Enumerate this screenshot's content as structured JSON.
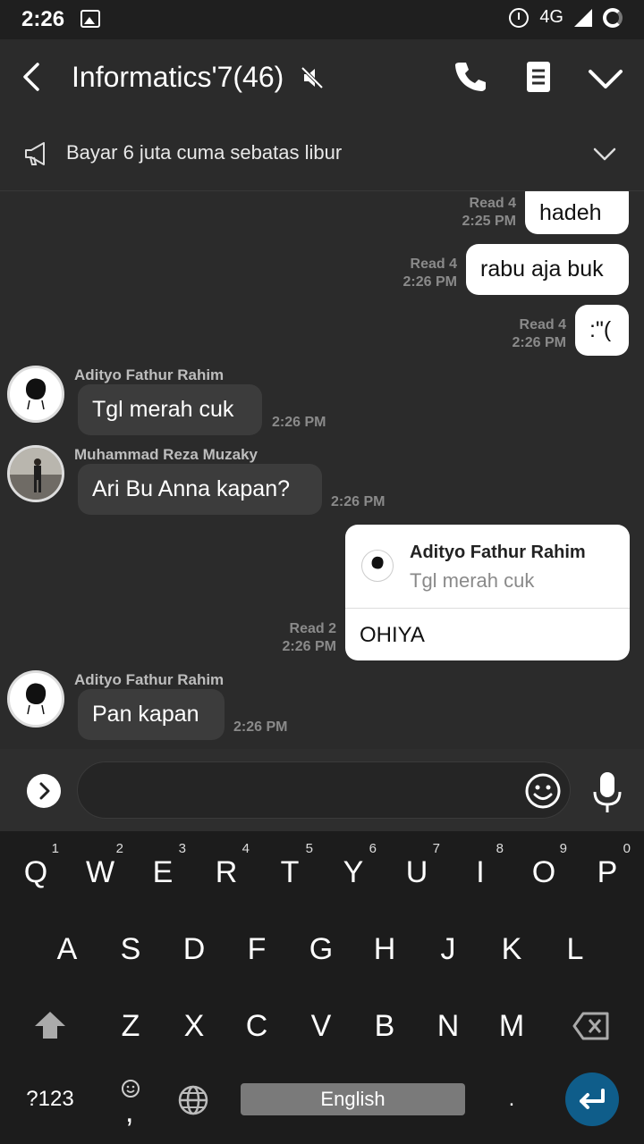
{
  "status_bar": {
    "time": "2:26",
    "network": "4G"
  },
  "header": {
    "title": "Informatics'7(46)",
    "icons": [
      "back-arrow-icon",
      "mute-icon",
      "phone-icon",
      "notes-icon",
      "chevron-down-icon"
    ]
  },
  "announcement": {
    "text": "Bayar 6 juta cuma sebatas libur"
  },
  "messages": [
    {
      "type": "outgoing",
      "text": "hadeh",
      "read": "Read 4",
      "time": "2:25 PM"
    },
    {
      "type": "outgoing",
      "text": "rabu aja buk",
      "read": "Read 4",
      "time": "2:26 PM"
    },
    {
      "type": "outgoing",
      "text": ":\"(",
      "read": "Read 4",
      "time": "2:26 PM"
    },
    {
      "type": "incoming",
      "sender": "Adityo Fathur Rahim",
      "text": "Tgl merah cuk",
      "time": "2:26 PM"
    },
    {
      "type": "incoming",
      "sender": "Muhammad Reza Muzaky",
      "text": "Ari Bu Anna kapan?",
      "time": "2:26 PM"
    },
    {
      "type": "outgoing-reply",
      "quoted_sender": "Adityo Fathur Rahim",
      "quoted_text": "Tgl merah cuk",
      "text": "OHIYA",
      "read": "Read 2",
      "time": "2:26 PM"
    },
    {
      "type": "incoming",
      "sender": "Adityo Fathur Rahim",
      "text": "Pan kapan",
      "time": "2:26 PM"
    }
  ],
  "input": {
    "placeholder": ""
  },
  "keyboard": {
    "row1": [
      "Q",
      "W",
      "E",
      "R",
      "T",
      "Y",
      "U",
      "I",
      "O",
      "P"
    ],
    "row1_hints": [
      "1",
      "2",
      "3",
      "4",
      "5",
      "6",
      "7",
      "8",
      "9",
      "0"
    ],
    "row2": [
      "A",
      "S",
      "D",
      "F",
      "G",
      "H",
      "J",
      "K",
      "L"
    ],
    "row3": [
      "Z",
      "X",
      "C",
      "V",
      "B",
      "N",
      "M"
    ],
    "symbols_key": "?123",
    "comma_key": ",",
    "period_key": ".",
    "space_label": "English"
  },
  "colors": {
    "background": "#2b2b2b",
    "outgoing_bubble": "#ffffff",
    "incoming_bubble": "#3c3c3c",
    "enter_key": "#0f5d8a"
  }
}
